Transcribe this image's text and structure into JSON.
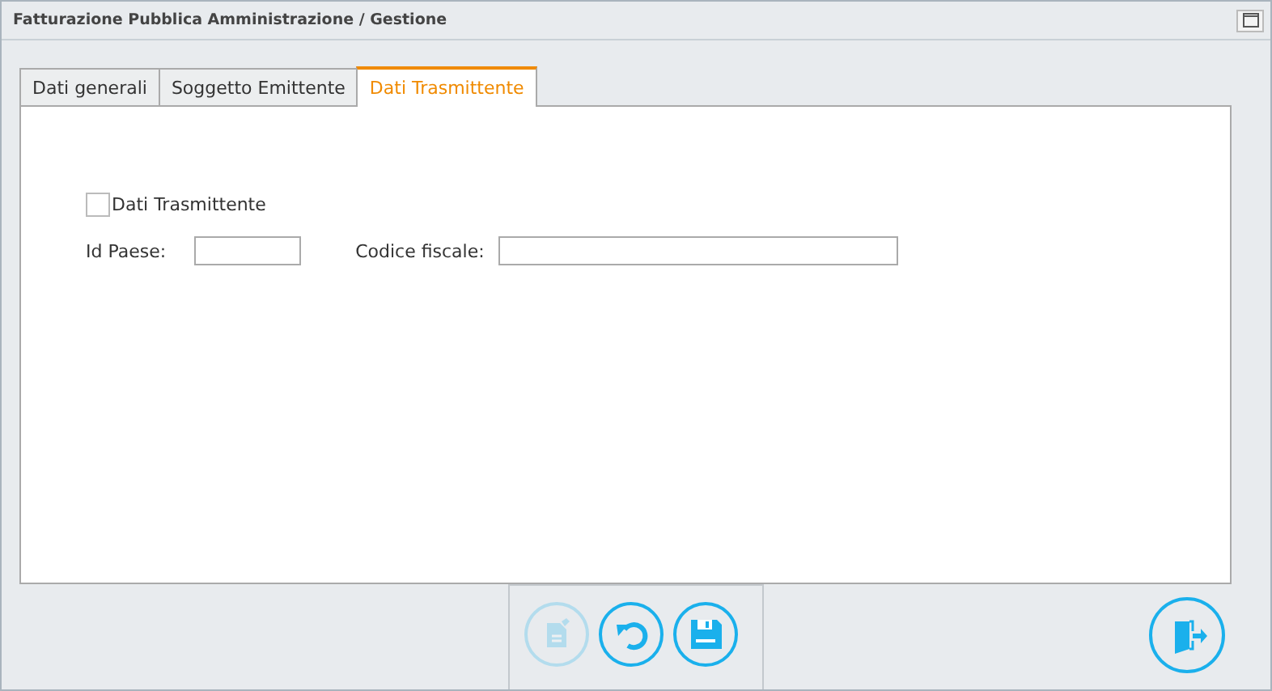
{
  "window": {
    "title": "Fatturazione Pubblica Amministrazione / Gestione"
  },
  "tabs": [
    {
      "label": "Dati generali",
      "selected": false
    },
    {
      "label": "Soggetto Emittente",
      "selected": false
    },
    {
      "label": "Dati Trasmittente",
      "selected": true
    }
  ],
  "form": {
    "checkbox": {
      "label": "Dati Trasmittente",
      "checked": false
    },
    "fields": [
      {
        "label": "Id Paese:",
        "kind": "short"
      },
      {
        "label": "Codice fiscale:",
        "kind": "long"
      }
    ]
  },
  "toolbar": [
    {
      "kind": "edit",
      "disabled": true
    },
    {
      "kind": "undo",
      "disabled": false
    },
    {
      "kind": "save",
      "disabled": false
    }
  ],
  "exit_button": {
    "kind": "exit",
    "disabled": false
  }
}
